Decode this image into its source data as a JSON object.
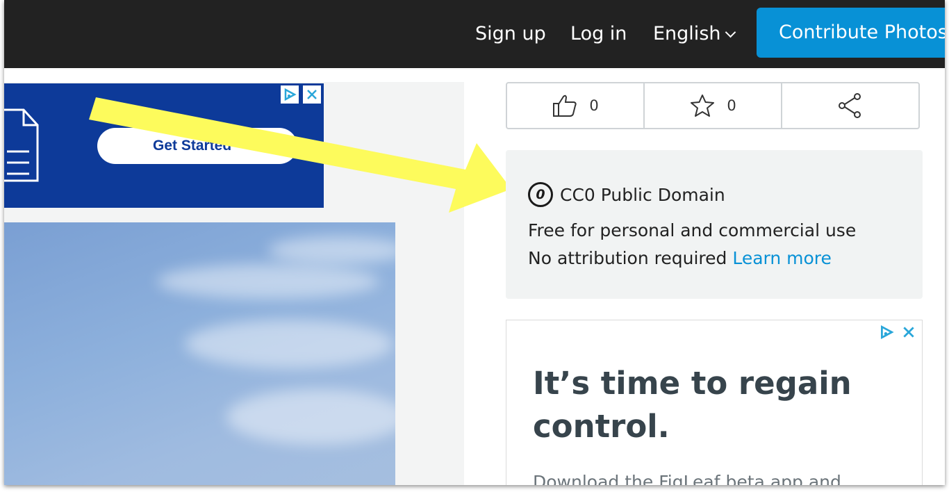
{
  "header": {
    "signup": "Sign up",
    "login": "Log in",
    "language": "English",
    "contribute": "Contribute Photos"
  },
  "ad_top": {
    "button": "Get Started"
  },
  "actions": {
    "likes": "0",
    "favorites": "0"
  },
  "license": {
    "icon_text": "0",
    "title": "CC0 Public Domain",
    "line1": "Free for personal and commercial use",
    "line2": "No attribution required",
    "learn_more": "Learn more"
  },
  "ad_side": {
    "headline": "It’s time to regain control.",
    "subtext": "Download the FigLeaf beta app and"
  },
  "colors": {
    "topbar": "#222222",
    "accent": "#0891d6",
    "arrow": "#fdfb5c",
    "ad_blue": "#0d3a99"
  },
  "icons": [
    "thumbs-up-icon",
    "star-icon",
    "share-icon",
    "adchoices-icon",
    "close-icon",
    "chevron-down-icon"
  ]
}
